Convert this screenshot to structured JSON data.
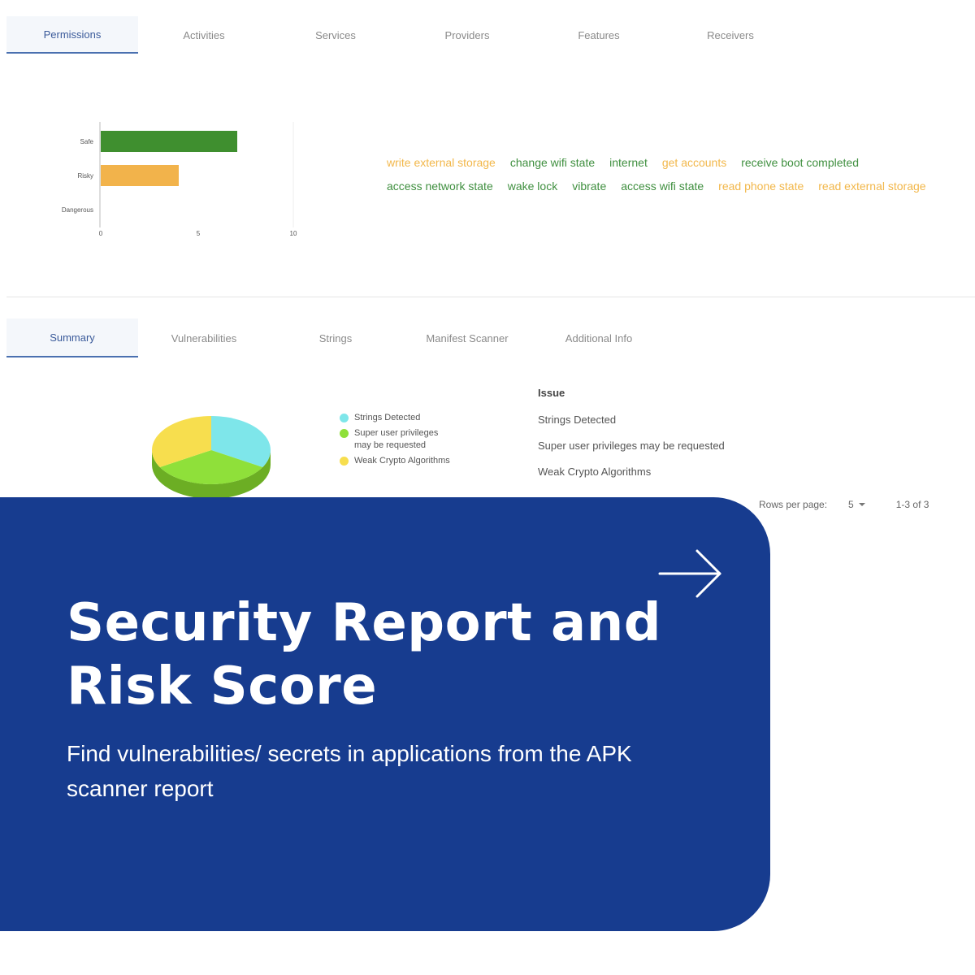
{
  "top_tabs": [
    "Permissions",
    "Activities",
    "Services",
    "Providers",
    "Features",
    "Receivers"
  ],
  "permissions_chart": {
    "chart_data": {
      "type": "bar",
      "orientation": "horizontal",
      "categories": [
        "Safe",
        "Risky",
        "Dangerous"
      ],
      "values": [
        7,
        4,
        0
      ],
      "colors": [
        "#3f8f2f",
        "#f2b34b",
        "#cccccc"
      ],
      "xlim": [
        0,
        10
      ],
      "xticks": [
        "0",
        "5",
        "10"
      ]
    }
  },
  "permission_tags": {
    "row1": [
      {
        "label": "write external storage",
        "level": "risky"
      },
      {
        "label": "change wifi state",
        "level": "normal"
      },
      {
        "label": "internet",
        "level": "normal"
      },
      {
        "label": "get accounts",
        "level": "risky"
      },
      {
        "label": "receive boot completed",
        "level": "normal"
      }
    ],
    "row2": [
      {
        "label": "access network state",
        "level": "normal"
      },
      {
        "label": "wake lock",
        "level": "normal"
      },
      {
        "label": "vibrate",
        "level": "normal"
      },
      {
        "label": "access wifi state",
        "level": "normal"
      },
      {
        "label": "read phone state",
        "level": "risky"
      },
      {
        "label": "read external storage",
        "level": "risky"
      }
    ]
  },
  "summary_tabs": [
    "Summary",
    "Vulnerabilities",
    "Strings",
    "Manifest Scanner",
    "Additional Info"
  ],
  "summary_chart": {
    "chart_data": {
      "type": "pie",
      "categories": [
        "Strings Detected",
        "Super user privileges may be requested",
        "Weak Crypto Algorithms"
      ],
      "values": [
        1,
        1,
        1
      ],
      "colors": [
        "#7ee6ea",
        "#8fe03a",
        "#f7de4e"
      ]
    }
  },
  "issues": {
    "header": "Issue",
    "rows": [
      "Strings Detected",
      "Super user privileges may be requested",
      "Weak Crypto Algorithms"
    ]
  },
  "pager": {
    "rows_label": "Rows per page:",
    "rows_value": "5",
    "range": "1-3 of 3"
  },
  "card": {
    "title": "Security Report and Risk Score",
    "subtitle": "Find vulnerabilities/ secrets in applications from the APK scanner report",
    "color": "#173c8f"
  }
}
